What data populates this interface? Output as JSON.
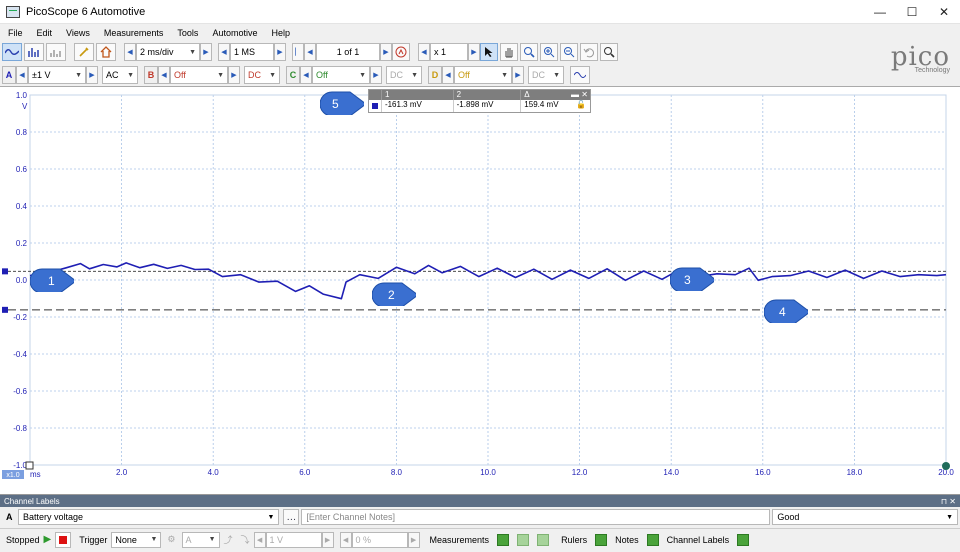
{
  "window": {
    "title": "PicoScope 6 Automotive",
    "controls": {
      "minimize": "—",
      "maximize": "☐",
      "close": "✕"
    }
  },
  "menu": [
    "File",
    "Edit",
    "Views",
    "Measurements",
    "Tools",
    "Automotive",
    "Help"
  ],
  "toolbar": {
    "timebase": "2 ms/div",
    "samples": "1 MS",
    "buffer": "1 of 1",
    "zoom": "x 1"
  },
  "channels": [
    {
      "letter": "A",
      "range": "±1 V",
      "coupling": "AC",
      "color": "#1f1fb4"
    },
    {
      "letter": "B",
      "range": "Off",
      "coupling": "DC",
      "color": "#c0392b"
    },
    {
      "letter": "C",
      "range": "Off",
      "coupling": "DC",
      "color": "#2e8b2e"
    },
    {
      "letter": "D",
      "range": "Off",
      "coupling": "DC",
      "color": "#c89a10"
    }
  ],
  "logo": {
    "word": "pico",
    "sub": "Technology"
  },
  "y_axis": {
    "unit": "V",
    "ticks": [
      "1.0",
      "0.8",
      "0.6",
      "0.4",
      "0.2",
      "0.0",
      "-0.2",
      "-0.4",
      "-0.6",
      "-0.8",
      "-1.0"
    ]
  },
  "x_axis": {
    "unit": "ms",
    "ticks": [
      "2.0",
      "4.0",
      "6.0",
      "8.0",
      "10.0",
      "12.0",
      "14.0",
      "16.0",
      "18.0",
      "20.0"
    ],
    "zoom_badge": "x1.0"
  },
  "measurements": {
    "headers": [
      "1",
      "2",
      "Δ"
    ],
    "values": [
      "-161.3 mV",
      "-1.898 mV",
      "159.4 mV"
    ]
  },
  "callouts": [
    "1",
    "2",
    "3",
    "4",
    "5"
  ],
  "trace": {
    "color": "#1f1fb4",
    "points_ms": [
      0,
      0.4,
      0.8,
      1.1,
      1.3,
      1.6,
      1.9,
      2.1,
      2.4,
      2.7,
      3.0,
      3.3,
      3.6,
      3.9,
      4.2,
      4.6,
      5.0,
      5.4,
      5.8,
      6.1,
      6.4,
      6.8,
      6.9,
      7.2,
      7.6,
      8.0,
      8.4,
      8.7,
      9.0,
      9.4,
      9.8,
      10.2,
      10.6,
      11.0,
      11.4,
      11.8,
      12.2,
      12.6,
      13.0,
      13.4,
      13.8,
      14.2,
      14.6,
      15.0,
      15.4,
      15.7,
      15.9,
      16.2,
      16.6,
      17.0,
      17.4,
      17.8,
      18.2,
      18.6,
      19.0,
      19.4,
      19.8,
      20.0
    ],
    "values_mV": [
      -25,
      -10,
      18,
      40,
      12,
      35,
      22,
      44,
      18,
      36,
      14,
      30,
      8,
      10,
      -30,
      -20,
      -60,
      -55,
      -110,
      -80,
      -125,
      -150,
      -60,
      -20,
      -40,
      20,
      -15,
      30,
      -10,
      25,
      -30,
      15,
      -35,
      10,
      -45,
      5,
      -40,
      12,
      -50,
      0,
      -45,
      10,
      -30,
      -15,
      -20,
      15,
      -50,
      -30,
      -25,
      0,
      -35,
      5,
      -40,
      0,
      -30,
      -20,
      -25,
      -20
    ]
  },
  "rulers": {
    "ruler1_mV": -161.3,
    "ruler2_mV": -1.898
  },
  "channel_labels": {
    "title": "Channel Labels",
    "row_letter": "A",
    "label": "Battery voltage",
    "notes_placeholder": "[Enter Channel Notes]",
    "status": "Good"
  },
  "statusbar": {
    "state": "Stopped",
    "trigger_label": "Trigger",
    "trigger_mode": "None",
    "trigger_channel": "A",
    "trigger_level": "1 V",
    "pretrigger": "0 %",
    "measurements_label": "Measurements",
    "rulers_label": "Rulers",
    "notes_label": "Notes",
    "channel_labels_label": "Channel Labels"
  }
}
